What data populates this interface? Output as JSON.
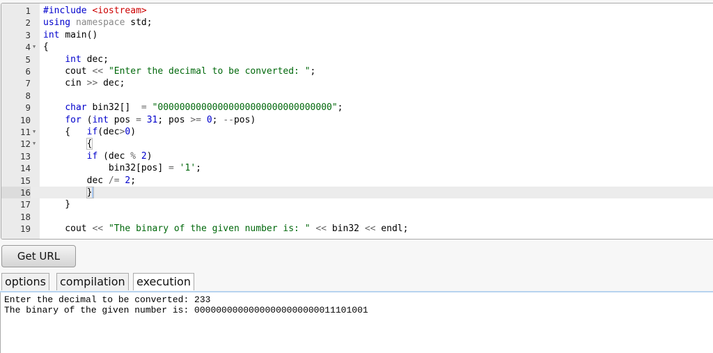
{
  "editor": {
    "active_line": 16,
    "lines": [
      {
        "n": 1,
        "t": [
          [
            "#include ",
            "kw"
          ],
          [
            "<iostream>",
            "inc"
          ]
        ]
      },
      {
        "n": 2,
        "t": [
          [
            "using ",
            "kw"
          ],
          [
            "namespace ",
            "ns"
          ],
          [
            "std;",
            ""
          ]
        ]
      },
      {
        "n": 3,
        "t": [
          [
            "int ",
            "kw"
          ],
          [
            "main()",
            ""
          ]
        ]
      },
      {
        "n": 4,
        "fold": true,
        "t": [
          [
            "{",
            ""
          ]
        ]
      },
      {
        "n": 5,
        "t": [
          [
            "    ",
            ""
          ],
          [
            "int ",
            "kw"
          ],
          [
            "dec;",
            ""
          ]
        ]
      },
      {
        "n": 6,
        "t": [
          [
            "    cout ",
            ""
          ],
          [
            "<< ",
            "op"
          ],
          [
            "\"Enter the decimal to be converted: \"",
            "str"
          ],
          [
            ";",
            ""
          ]
        ]
      },
      {
        "n": 7,
        "t": [
          [
            "    cin ",
            ""
          ],
          [
            ">> ",
            "op"
          ],
          [
            "dec;",
            ""
          ]
        ]
      },
      {
        "n": 8,
        "t": []
      },
      {
        "n": 9,
        "t": [
          [
            "    ",
            ""
          ],
          [
            "char ",
            "kw"
          ],
          [
            "bin32[]  ",
            ""
          ],
          [
            "= ",
            "op"
          ],
          [
            "\"00000000000000000000000000000000\"",
            "str"
          ],
          [
            ";",
            ""
          ]
        ]
      },
      {
        "n": 10,
        "t": [
          [
            "    ",
            ""
          ],
          [
            "for ",
            "kw"
          ],
          [
            "(",
            ""
          ],
          [
            "int ",
            "kw"
          ],
          [
            "pos ",
            ""
          ],
          [
            "= ",
            "op"
          ],
          [
            "31",
            "num"
          ],
          [
            "; pos ",
            ""
          ],
          [
            ">= ",
            "op"
          ],
          [
            "0",
            "num"
          ],
          [
            "; ",
            ""
          ],
          [
            "--",
            "op"
          ],
          [
            "pos)",
            ""
          ]
        ]
      },
      {
        "n": 11,
        "fold": true,
        "t": [
          [
            "    {   ",
            ""
          ],
          [
            "if",
            "kw"
          ],
          [
            "(dec",
            ""
          ],
          [
            ">",
            "op"
          ],
          [
            "0",
            "num"
          ],
          [
            ")",
            ""
          ]
        ]
      },
      {
        "n": 12,
        "fold": true,
        "t": [
          [
            "        ",
            ""
          ],
          [
            "{",
            "brk"
          ]
        ]
      },
      {
        "n": 13,
        "t": [
          [
            "        ",
            ""
          ],
          [
            "if ",
            "kw"
          ],
          [
            "(dec ",
            ""
          ],
          [
            "% ",
            "op"
          ],
          [
            "2",
            "num"
          ],
          [
            ")",
            ""
          ]
        ]
      },
      {
        "n": 14,
        "t": [
          [
            "            bin32[pos] ",
            ""
          ],
          [
            "= ",
            "op"
          ],
          [
            "'1'",
            "str"
          ],
          [
            ";",
            ""
          ]
        ]
      },
      {
        "n": 15,
        "t": [
          [
            "        dec ",
            ""
          ],
          [
            "/= ",
            "op"
          ],
          [
            "2",
            "num"
          ],
          [
            ";",
            ""
          ]
        ]
      },
      {
        "n": 16,
        "t": [
          [
            "        ",
            ""
          ],
          [
            "}",
            "brk cursor"
          ]
        ]
      },
      {
        "n": 17,
        "t": [
          [
            "    }",
            ""
          ]
        ]
      },
      {
        "n": 18,
        "t": []
      },
      {
        "n": 19,
        "t": [
          [
            "    cout ",
            ""
          ],
          [
            "<< ",
            "op"
          ],
          [
            "\"The binary of the given number is: \"",
            "str"
          ],
          [
            " ",
            ""
          ],
          [
            "<< ",
            "op"
          ],
          [
            "bin32 ",
            ""
          ],
          [
            "<< ",
            "op"
          ],
          [
            "endl;",
            ""
          ]
        ]
      }
    ]
  },
  "get_url_label": "Get URL",
  "tabs": [
    {
      "label": "options"
    },
    {
      "label": "compilation"
    },
    {
      "label": "execution",
      "selected": true
    }
  ],
  "output": {
    "line1": "Enter the decimal to be converted: 233",
    "line2": "The binary of the given number is: 00000000000000000000000011101001"
  }
}
